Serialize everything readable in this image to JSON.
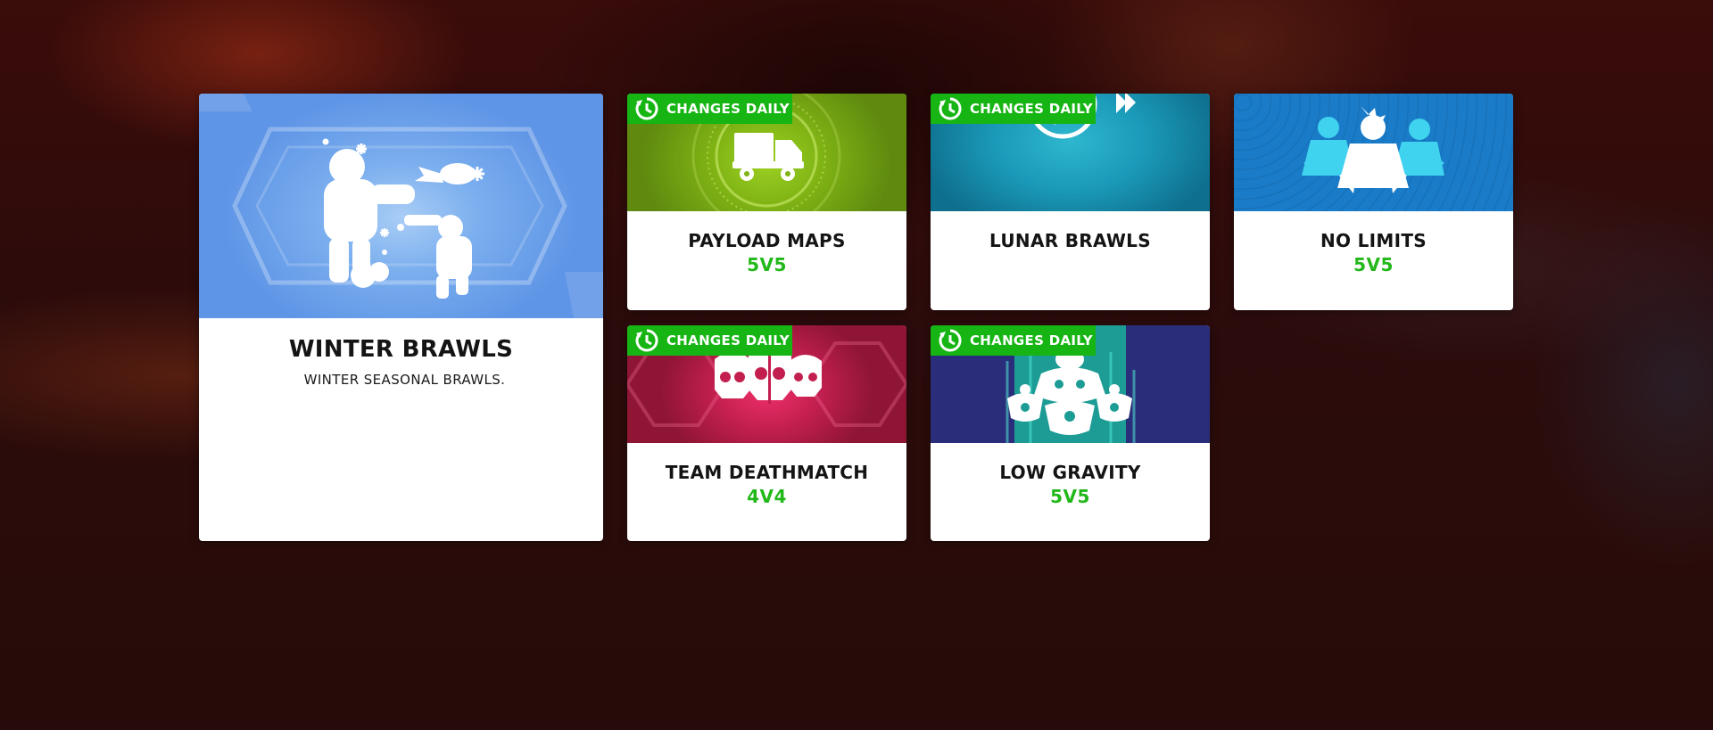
{
  "colors": {
    "card_bg": "#ffffff",
    "badge_green": "#16b513",
    "mode_green": "#22b81a",
    "title_text": "#141414"
  },
  "featured": {
    "title": "WINTER BRAWLS",
    "description": "WINTER SEASONAL BRAWLS.",
    "icon": "snowball-fight-icon",
    "banner_color": "#5f95e6"
  },
  "cards": [
    {
      "title": "PAYLOAD MAPS",
      "mode": "5V5",
      "badge": "CHANGES DAILY",
      "icon": "payload-truck-icon",
      "banner_color": "#6a9a12"
    },
    {
      "title": "LUNAR BRAWLS",
      "mode": "",
      "badge": "CHANGES DAILY",
      "icon": "lunar-clock-icon",
      "banner_color": "#1a9ab8"
    },
    {
      "title": "NO LIMITS",
      "mode": "5V5",
      "badge": "",
      "icon": "hero-group-icon",
      "banner_color": "#1776c4"
    },
    {
      "title": "TEAM DEATHMATCH",
      "mode": "4V4",
      "badge": "CHANGES DAILY",
      "icon": "skulls-icon",
      "banner_color": "#b51e48"
    },
    {
      "title": "LOW GRAVITY",
      "mode": "5V5",
      "badge": "CHANGES DAILY",
      "icon": "low-gravity-icon",
      "banner_color": "#2a2e7a"
    }
  ]
}
